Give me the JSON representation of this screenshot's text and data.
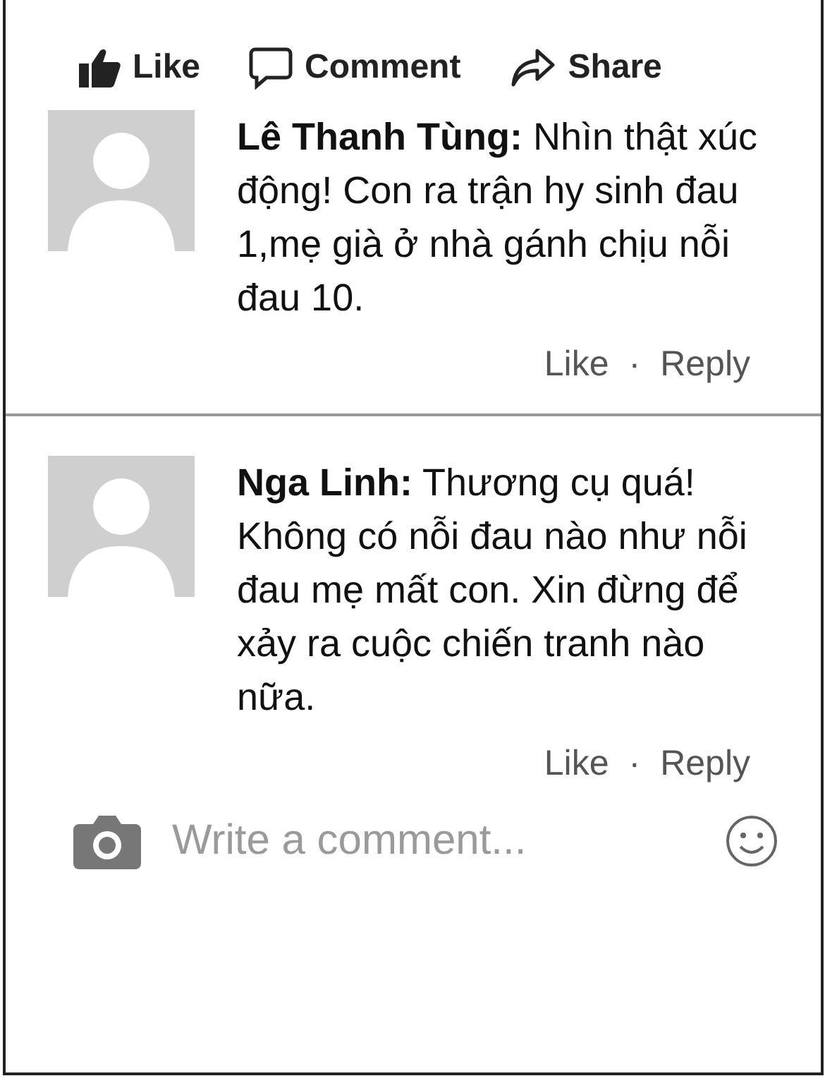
{
  "actions": [
    {
      "kind": "like",
      "label": "Like"
    },
    {
      "kind": "comment",
      "label": "Comment"
    },
    {
      "kind": "share",
      "label": "Share"
    }
  ],
  "comments": [
    {
      "text": "**Lê Thanh Tùng:** Nhìn thật xúc động! Con ra trận hy sinh đau 1,mẹ già ở nhà gánh chịu nỗi đau 10.",
      "like": "Like",
      "separator": "·",
      "reply": "Reply"
    },
    {
      "text": "**Nga Linh:** Thương cụ quá! Không có nỗi đau nào như nỗi đau mẹ mất con. Xin đừng để xảy ra cuộc chiến tranh nào nữa.",
      "like": "Like",
      "separator": "·",
      "reply": "Reply"
    }
  ],
  "composer": {
    "placeholder": "Write a comment..."
  }
}
